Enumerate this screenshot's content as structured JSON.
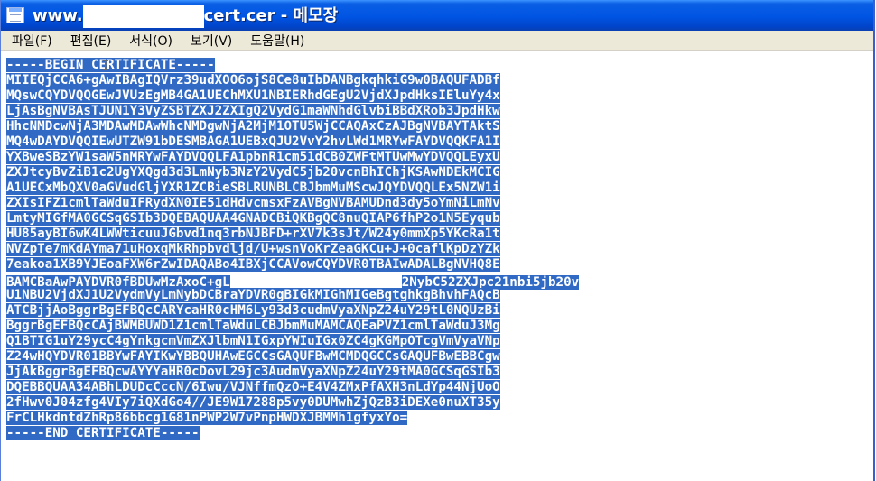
{
  "window": {
    "title_prefix": "www.",
    "title_suffix": "cert.cer - 메모장"
  },
  "menu": [
    "파일(F)",
    "편집(E)",
    "서식(O)",
    "보기(V)",
    "도움말(H)"
  ],
  "icons": {
    "app": "notepad-icon",
    "cursor": "text-cursor-icon"
  },
  "colors": {
    "selection": "#316ac5",
    "titlebar": "#0054e3",
    "menubar": "#ece9d8"
  },
  "document": {
    "lines": [
      "-----BEGIN CERTIFICATE-----",
      "MIIEQjCCA6+gAwIBAgIQVrz39udXOO6ojS8Ce8uIbDANBgkqhkiG9w0BAQUFADBf",
      "MQswCQYDVQQGEwJVUzEgMB4GA1UEChMXU1NBIERhdGEgU2VjdXJpdHksIEluYy4x",
      "LjAsBgNVBAsTJUN1Y3VyZSBTZXJ2ZXIgQ2VydG1maWNhdGlvbiBBdXRob3JpdHkw",
      "HhcNMDcwNjA3MDAwMDAwWhcNMDgwNjA2MjM1OTU5WjCCAQAxCzAJBgNVBAYTAktS",
      "MQ4wDAYDVQQIEwUTZW91bDESMBAGA1UEBxQJU2VvY2hvLWd1MRYwFAYDVQQKFA1I",
      "YXBweSBzYW1saW5nMRYwFAYDVQQLFA1pbnR1cm51dCB0ZWFtMTUwMwYDVQQLEyxU",
      "ZXJtcyBvZiB1c2UgYXQgd3d3LmNyb3NzY2VydC5jb20vcnBhIChjKSAwNDEkMCIG",
      "A1UECxMbQXV0aGVudGljYXR1ZCBieSBLRUNBLCBJbmMuMScwJQYDVQQLEx5NZW1i",
      "ZXIsIFZ1cmlTaWduIFRydXN0IE51dHdvcmsxFzAVBgNVBAMUDnd3dy5oYmNiLmNv",
      "LmtyMIGfMA0GCSqGSIb3DQEBAQUAA4GNADCBiQKBgQC8nuQIAP6fhP2o1N5Eyqub",
      "HU85ayBI6wK4LWWticuuJGbvd1nq3rbNJBFD+rXV7k3sJt/W24y0mmXp5YKcRa1t",
      "NVZpTe7mKdAYma71uHoxqMkRhpbvdljd/U+wsnVoKrZeaGKCu+J+0caflKpDzYZk",
      "7eakoa1XB9YJEoaFXW6rZwIDAQABo4IBXjCCAVowCQYDVR0TBAIwADALBgNVHQ8E",
      "BAMCBaAwPAYDVR0fBDUwMzAxoC+gL",
      "U1NBU2VjdXJ1U2VydmVyLmNybDCBraYDVR0gBIGkMIGhMIGeBgtghkgBhvhFAQcB",
      "ATCBjjAoBggrBgEFBQcCARYcaHR0cHM6Ly93d3cudmVyaXNpZ24uY29tL0NQUzBi",
      "BggrBgEFBQcCAjBWMBUWD1Z1cmlTaWduLCBJbmMuMAMCAQEaPVZ1cmlTaWduJ3Mg",
      "Q1BTIG1uY29ycC4gYnkgcmVmZXJlbmN1IGxpYWIuIGx0ZC4gKGMpOTcgVmVyaVNp",
      "Z24wHQYDVR01BBYwFAYIKwYBBQUHAwEGCCsGAQUFBwMCMDQGCCsGAQUFBwEBBCgw",
      "JjAkBggrBgEFBQcwAYYYaHR0cDovL29jc3AudmVyaXNpZ24uY29tMA0GCSqGSIb3",
      "DQEBBQUAA34ABhLDUDcCccN/6Iwu/VJNffmQzO+E4V4ZMxPfAXH3nLdYp44NjUoO",
      "2fHwv0J04zfg4VIy7iQXdGo4//JE9W17288p5vy0DUMwhZjQzB3iDEXe0nuXT35y",
      "FrCLHkdntdZhRp86bbcg1G81nPWP2W7vPnpHWDXJBMMh1gfyxYo=",
      "-----END CERTIFICATE-----"
    ],
    "line15_tail": "2NybC52ZXJpc21nbi5jb20v"
  }
}
